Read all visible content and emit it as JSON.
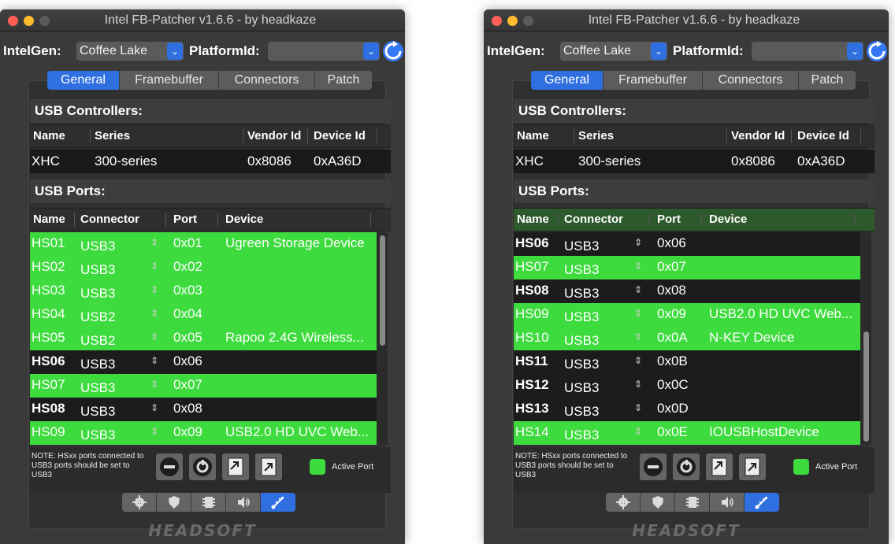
{
  "windows": [
    {
      "title": "Intel FB-Patcher v1.6.6 - by headkaze",
      "intelgen_label": "IntelGen:",
      "intelgen_value": "Coffee Lake",
      "platform_label": "PlatformId:",
      "platform_value": "",
      "tabs": [
        "General",
        "Framebuffer",
        "Connectors",
        "Patch"
      ],
      "controllers_title": "USB Controllers:",
      "controllers_headers": [
        "Name",
        "Series",
        "Vendor Id",
        "Device Id"
      ],
      "controller": {
        "name": "XHC",
        "series": "300-series",
        "vendor": "0x8086",
        "device": "0xA36D"
      },
      "ports_title": "USB Ports:",
      "ports_headers": [
        "Name",
        "Connector",
        "Port",
        "Device"
      ],
      "ports": [
        {
          "name": "HS01",
          "connector": "USB3",
          "port": "0x01",
          "device": "Ugreen Storage Device",
          "active": true
        },
        {
          "name": "HS02",
          "connector": "USB3",
          "port": "0x02",
          "device": "",
          "active": true
        },
        {
          "name": "HS03",
          "connector": "USB3",
          "port": "0x03",
          "device": "",
          "active": true
        },
        {
          "name": "HS04",
          "connector": "USB2",
          "port": "0x04",
          "device": "",
          "active": true
        },
        {
          "name": "HS05",
          "connector": "USB2",
          "port": "0x05",
          "device": "Rapoo 2.4G Wireless...",
          "active": true
        },
        {
          "name": "HS06",
          "connector": "USB3",
          "port": "0x06",
          "device": "",
          "active": false
        },
        {
          "name": "HS07",
          "connector": "USB3",
          "port": "0x07",
          "device": "",
          "active": true
        },
        {
          "name": "HS08",
          "connector": "USB3",
          "port": "0x08",
          "device": "",
          "active": false
        },
        {
          "name": "HS09",
          "connector": "USB3",
          "port": "0x09",
          "device": "USB2.0 HD UVC Web...",
          "active": true
        }
      ],
      "scroll_position": 0.0,
      "note": "NOTE: HSxx ports connected to USB3 ports should be set to USB3",
      "active_port_label": "Active Port",
      "logo": "HEADSOFT"
    },
    {
      "title": "Intel FB-Patcher v1.6.6 - by headkaze",
      "intelgen_label": "IntelGen:",
      "intelgen_value": "Coffee Lake",
      "platform_label": "PlatformId:",
      "platform_value": "",
      "tabs": [
        "General",
        "Framebuffer",
        "Connectors",
        "Patch"
      ],
      "controllers_title": "USB Controllers:",
      "controllers_headers": [
        "Name",
        "Series",
        "Vendor Id",
        "Device Id"
      ],
      "controller": {
        "name": "XHC",
        "series": "300-series",
        "vendor": "0x8086",
        "device": "0xA36D"
      },
      "ports_title": "USB Ports:",
      "ports_headers": [
        "Name",
        "Connector",
        "Port",
        "Device"
      ],
      "ports": [
        {
          "name": "HS06",
          "connector": "USB3",
          "port": "0x06",
          "device": "",
          "active": false
        },
        {
          "name": "HS07",
          "connector": "USB3",
          "port": "0x07",
          "device": "",
          "active": true
        },
        {
          "name": "HS08",
          "connector": "USB3",
          "port": "0x08",
          "device": "",
          "active": false
        },
        {
          "name": "HS09",
          "connector": "USB3",
          "port": "0x09",
          "device": "USB2.0 HD UVC Web...",
          "active": true
        },
        {
          "name": "HS10",
          "connector": "USB3",
          "port": "0x0A",
          "device": "N-KEY Device",
          "active": true
        },
        {
          "name": "HS11",
          "connector": "USB3",
          "port": "0x0B",
          "device": "",
          "active": false
        },
        {
          "name": "HS12",
          "connector": "USB3",
          "port": "0x0C",
          "device": "",
          "active": false
        },
        {
          "name": "HS13",
          "connector": "USB3",
          "port": "0x0D",
          "device": "",
          "active": false
        },
        {
          "name": "HS14",
          "connector": "USB3",
          "port": "0x0E",
          "device": "IOUSBHostDevice",
          "active": true
        }
      ],
      "scroll_position": 1.0,
      "note": "NOTE: HSxx ports connected to USB3 ports should be set to USB3",
      "active_port_label": "Active Port",
      "logo": "HEADSOFT"
    }
  ],
  "colors": {
    "accent": "#2f6fe0",
    "active_row": "#3ddb3d",
    "inactive_row": "#1c1c1c"
  },
  "icons": {
    "toolbar": [
      "remove-icon",
      "refresh-circle-icon",
      "import-icon",
      "export-icon"
    ],
    "iconbar": [
      "gear-icon",
      "shield-icon",
      "chip-icon",
      "speaker-icon",
      "usb-icon"
    ]
  }
}
